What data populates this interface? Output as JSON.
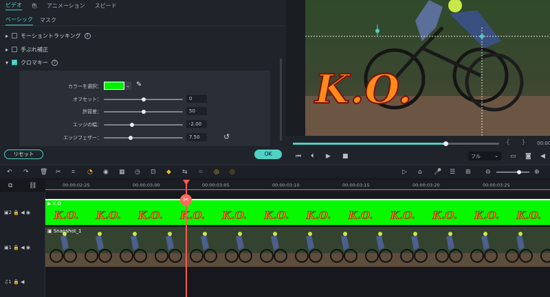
{
  "left_panel": {
    "tabs": [
      "ビデオ",
      "色",
      "アニメーション",
      "スピード"
    ],
    "subtabs": [
      "ベーシック",
      "マスク"
    ],
    "sections": [
      {
        "label": "モーショントラッキング",
        "checked": false
      },
      {
        "label": "手ぶれ補正",
        "checked": false
      },
      {
        "label": "クロマキー",
        "checked": true
      }
    ],
    "chroma": {
      "color_label": "カラーを選択：",
      "color_value": "#00f000",
      "params": [
        {
          "label": "オフセット：",
          "value": "0",
          "level": 0.5
        },
        {
          "label": "許容差：",
          "value": "50",
          "level": 0.5
        },
        {
          "label": "エッジの幅：",
          "value": "-2.00",
          "level": 0.35
        },
        {
          "label": "エッジフェザー：",
          "value": "7.50",
          "level": 0.33
        }
      ]
    },
    "reset_label": "リセット",
    "ok_label": "OK"
  },
  "preview": {
    "overlay_text": "K.O.",
    "progress": 0.75,
    "timecode": "00:00",
    "brackets": "{      }",
    "quality_label": "フル"
  },
  "timeline": {
    "ruler_labels": [
      "00:00:02:25",
      "00:00:03:00",
      "00:00:03:05",
      "00:00:03:10",
      "00:00:03:15",
      "00:00:03:20",
      "00:00:03:25"
    ],
    "tracks": [
      {
        "number": "2",
        "clip_name": "K.O",
        "clip_label": "K.O."
      },
      {
        "number": "1",
        "clip_name": "Snapshot_1"
      },
      {
        "number": "1"
      }
    ]
  },
  "colors": {
    "accent": "#4fd1c5",
    "chroma_green": "#08f800",
    "playhead": "#ff5a4e"
  }
}
